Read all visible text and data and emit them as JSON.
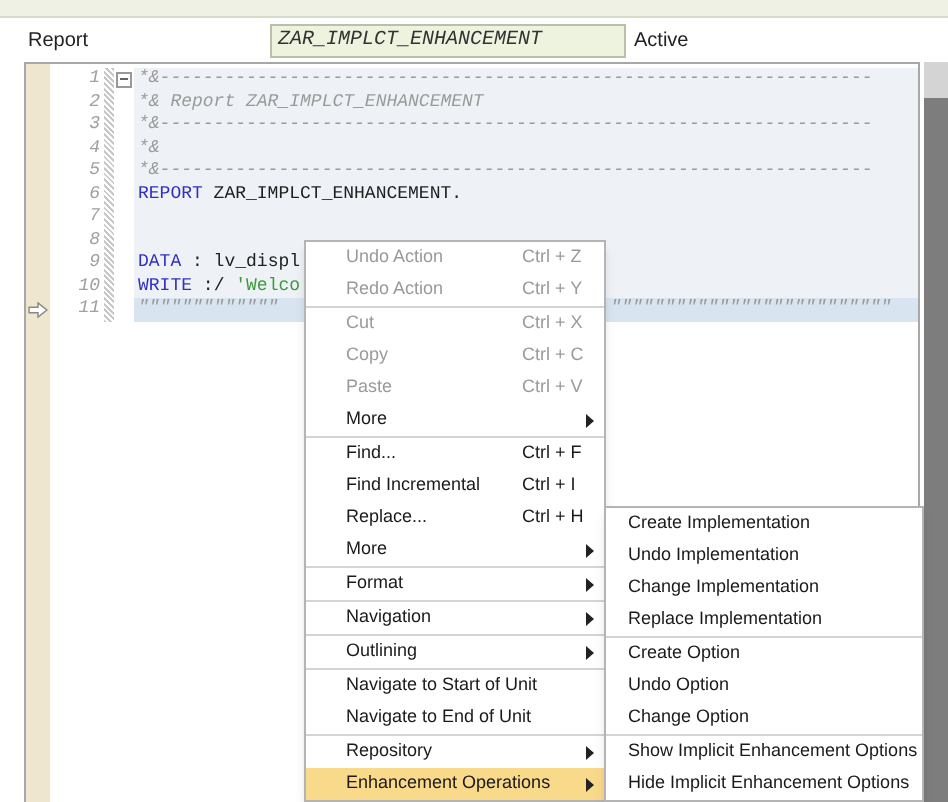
{
  "header": {
    "label": "Report",
    "program": "ZAR_IMPLCT_ENHANCEMENT",
    "status": "Active"
  },
  "code_lines": [
    {
      "number": "1",
      "fold": true,
      "current": false,
      "tokens": [
        {
          "text": "*&------------------------------------------------------------------",
          "kind": "comment"
        }
      ]
    },
    {
      "number": "2",
      "fold": false,
      "current": false,
      "tokens": [
        {
          "text": "*& Report ZAR_IMPLCT_ENHANCEMENT",
          "kind": "comment"
        }
      ]
    },
    {
      "number": "3",
      "fold": false,
      "current": false,
      "tokens": [
        {
          "text": "*&------------------------------------------------------------------",
          "kind": "comment"
        }
      ]
    },
    {
      "number": "4",
      "fold": false,
      "current": false,
      "tokens": [
        {
          "text": "*&",
          "kind": "comment"
        }
      ]
    },
    {
      "number": "5",
      "fold": false,
      "current": false,
      "tokens": [
        {
          "text": "*&------------------------------------------------------------------",
          "kind": "comment"
        }
      ]
    },
    {
      "number": "6",
      "fold": false,
      "current": false,
      "tokens": [
        {
          "text": "REPORT",
          "kind": "keyword"
        },
        {
          "text": " ZAR_IMPLCT_ENHANCEMENT.",
          "kind": "plain"
        }
      ]
    },
    {
      "number": "7",
      "fold": false,
      "current": false
    },
    {
      "number": "8",
      "fold": false,
      "current": false
    },
    {
      "number": "9",
      "fold": false,
      "current": false,
      "tokens": [
        {
          "text": "DATA",
          "kind": "keyword"
        },
        {
          "text": " : lv_displ",
          "kind": "plain"
        }
      ]
    },
    {
      "number": "10",
      "fold": false,
      "current": false,
      "tokens": [
        {
          "text": "WRITE",
          "kind": "keyword"
        },
        {
          "text": " :/ ",
          "kind": "plain"
        },
        {
          "text": "'Welco",
          "kind": "string"
        }
      ]
    },
    {
      "number": "11",
      "fold": false,
      "current": true,
      "tokens": [
        {
          "text": "\"\"\"\"\"\"\"\"\"\"\"\"\"",
          "kind": "comment"
        },
        {
          "text": "\"\"\"\"\"\"\"\"\"\"\"\"\"\"\"\"\"\"\"\"\"\"\"\"\"\"",
          "kind": "comment",
          "after_menu": true
        }
      ]
    }
  ],
  "context_menu": {
    "groups": [
      [
        {
          "label": "Undo Action",
          "shortcut": "Ctrl + Z",
          "disabled": true,
          "submenu": false,
          "selected": false
        },
        {
          "label": "Redo Action",
          "shortcut": "Ctrl + Y",
          "disabled": true,
          "submenu": false,
          "selected": false
        }
      ],
      [
        {
          "label": "Cut",
          "shortcut": "Ctrl + X",
          "disabled": true,
          "submenu": false,
          "selected": false
        },
        {
          "label": "Copy",
          "shortcut": "Ctrl + C",
          "disabled": true,
          "submenu": false,
          "selected": false
        },
        {
          "label": "Paste",
          "shortcut": "Ctrl + V",
          "disabled": true,
          "submenu": false,
          "selected": false
        },
        {
          "label": "More",
          "disabled": false,
          "submenu": true,
          "selected": false
        }
      ],
      [
        {
          "label": "Find...",
          "shortcut": "Ctrl + F",
          "disabled": false,
          "submenu": false,
          "selected": false
        },
        {
          "label": "Find Incremental",
          "shortcut": "Ctrl + I",
          "disabled": false,
          "submenu": false,
          "selected": false
        },
        {
          "label": "Replace...",
          "shortcut": "Ctrl + H",
          "disabled": false,
          "submenu": false,
          "selected": false
        },
        {
          "label": "More",
          "disabled": false,
          "submenu": true,
          "selected": false
        }
      ],
      [
        {
          "label": "Format",
          "disabled": false,
          "submenu": true,
          "selected": false
        }
      ],
      [
        {
          "label": "Navigation",
          "disabled": false,
          "submenu": true,
          "selected": false
        }
      ],
      [
        {
          "label": "Outlining",
          "disabled": false,
          "submenu": true,
          "selected": false
        }
      ],
      [
        {
          "label": "Navigate to Start of Unit",
          "disabled": false,
          "submenu": false,
          "selected": false
        },
        {
          "label": "Navigate to End of Unit",
          "disabled": false,
          "submenu": false,
          "selected": false
        }
      ],
      [
        {
          "label": "Repository",
          "disabled": false,
          "submenu": true,
          "selected": false
        },
        {
          "label": "Enhancement Operations",
          "disabled": false,
          "submenu": true,
          "selected": true
        }
      ]
    ]
  },
  "submenu": {
    "groups": [
      [
        {
          "label": "Create Implementation"
        },
        {
          "label": "Undo Implementation"
        },
        {
          "label": "Change Implementation"
        },
        {
          "label": "Replace Implementation"
        }
      ],
      [
        {
          "label": "Create Option"
        },
        {
          "label": "Undo Option"
        },
        {
          "label": "Change Option"
        }
      ],
      [
        {
          "label": "Show Implicit Enhancement Options"
        },
        {
          "label": "Hide Implicit Enhancement Options"
        }
      ]
    ]
  }
}
